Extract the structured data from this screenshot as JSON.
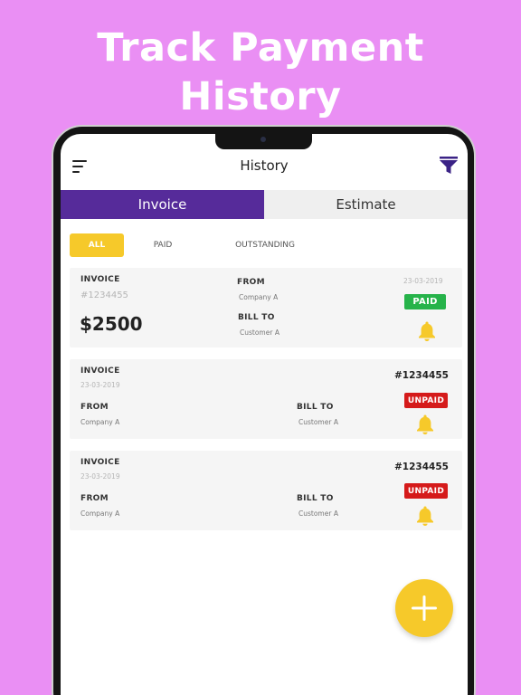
{
  "headline": {
    "line1": "Track Payment",
    "line2": "History"
  },
  "header": {
    "title": "History",
    "menu_icon": "hamburger-menu-icon",
    "filter_icon": "filter-funnel-icon"
  },
  "tabs": [
    {
      "label": "Invoice",
      "active": true
    },
    {
      "label": "Estimate",
      "active": false
    }
  ],
  "filters": [
    {
      "label": "ALL",
      "active": true
    },
    {
      "label": "PAID",
      "active": false
    },
    {
      "label": "OUTSTANDING",
      "active": false
    }
  ],
  "cards": [
    {
      "invoice_label": "INVOICE",
      "invoice_number": "#1234455",
      "amount": "$2500",
      "from_label": "FROM",
      "from_value": "Company A",
      "bill_to_label": "BILL TO",
      "bill_to_value": "Customer A",
      "date": "23-03-2019",
      "status": "PAID"
    },
    {
      "invoice_label": "INVOICE",
      "date": "23-03-2019",
      "invoice_number": "#1234455",
      "from_label": "FROM",
      "from_value": "Company A",
      "bill_to_label": "BILL TO",
      "bill_to_value": "Customer A",
      "status": "UNPAID"
    },
    {
      "invoice_label": "INVOICE",
      "date": "23-03-2019",
      "invoice_number": "#1234455",
      "from_label": "FROM",
      "from_value": "Company A",
      "bill_to_label": "BILL TO",
      "bill_to_value": "Customer A",
      "status": "UNPAID"
    }
  ],
  "fab": {
    "icon": "plus-icon"
  },
  "colors": {
    "background": "#ea8ff4",
    "primary": "#562b9a",
    "accent": "#f6c92a",
    "paid": "#26b34a",
    "unpaid": "#d51a1a"
  }
}
